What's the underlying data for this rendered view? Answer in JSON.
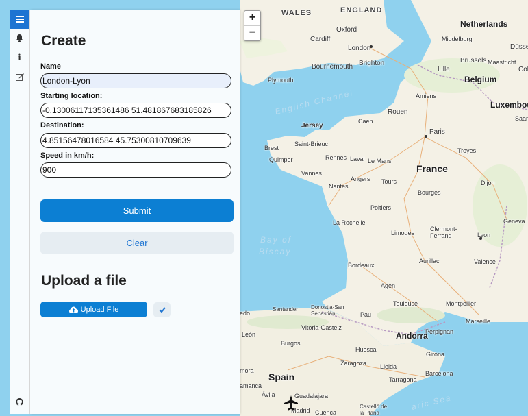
{
  "map": {
    "zoom_in": "+",
    "zoom_out": "−",
    "labels": {
      "wales": "WALES",
      "england": "ENGLAND",
      "netherlands": "Netherlands",
      "oxford": "Oxford",
      "cardiff": "Cardiff",
      "london": "London",
      "middelburg": "Middelburg",
      "dusse": "Düsse",
      "bournemouth": "Bournemouth",
      "brighton": "Brighton",
      "brussels": "Brussels",
      "maastricht": "Maastricht",
      "lille": "Lille",
      "belgium": "Belgium",
      "col": "Col",
      "plymouth": "Plymouth",
      "english_channel": "English Channel",
      "amiens": "Amiens",
      "luxembourg": "Luxembour",
      "rouen": "Rouen",
      "saarb": "Saarb",
      "jersey": "Jersey",
      "caen": "Caen",
      "paris": "Paris",
      "brest": "Brest",
      "saint_brieuc": "Saint-Brieuc",
      "troyes": "Troyes",
      "quimper": "Quimper",
      "rennes": "Rennes",
      "laval": "Laval",
      "le_mans": "Le Mans",
      "vannes": "Vannes",
      "france": "France",
      "angers": "Angers",
      "tours": "Tours",
      "dijon": "Dijon",
      "nantes": "Nantes",
      "bourges": "Bourges",
      "poitiers": "Poitiers",
      "geneva": "Geneva",
      "la_rochelle": "La Rochelle",
      "limoges": "Limoges",
      "clermont": "Clermont-\nFerrand",
      "lyon": "Lyon",
      "bay": "Bay of",
      "biscay": "Biscay",
      "bordeaux": "Bordeaux",
      "aurillac": "Aurillac",
      "valence": "Valence",
      "agen": "Agen",
      "toulouse": "Toulouse",
      "montpellier": "Montpellier",
      "santander": "Santander",
      "donostia": "Donostia-San\nSebastián",
      "pau": "Pau",
      "marseille": "Marseille",
      "edo": "edo",
      "vitoria": "Vitoria-Gasteiz",
      "perpignan": "Perpignan",
      "andorra": "Andorra",
      "leon": "León",
      "burgos": "Burgos",
      "huesca": "Huesca",
      "girona": "Girona",
      "zaragoza": "Zaragoza",
      "lleida": "Lleida",
      "barcelona": "Barcelona",
      "mora": "mora",
      "spain": "Spain",
      "tarragona": "Tarragona",
      "amanca": "amanca",
      "avila": "Ávila",
      "guadalajara": "Guadalajara",
      "castellon": "Castelló de\nla Plana",
      "madrid": "Madrid",
      "cuenca": "Cuenca",
      "aric_sea": "aric Sea"
    }
  },
  "sidebar": {
    "tabs": [
      {
        "icon": "menu-icon",
        "glyph": "≡"
      },
      {
        "icon": "bell-icon",
        "glyph": "🔔"
      },
      {
        "icon": "info-icon",
        "glyph": "i"
      },
      {
        "icon": "edit-icon",
        "glyph": "✎"
      }
    ],
    "bottom_icon": "github-icon"
  },
  "panel": {
    "title": "Create",
    "name_label": "Name",
    "name_value": "London-Lyon",
    "start_label": "Starting location:",
    "start_value": "-0.13006117135361486 51.481867683185826",
    "dest_label": "Destination:",
    "dest_value": "4.85156478016584 45.75300810709639",
    "speed_label": "Speed in km/h:",
    "speed_value": "900",
    "submit_label": "Submit",
    "clear_label": "Clear",
    "upload_title": "Upload a file",
    "upload_label": "Upload File"
  },
  "colors": {
    "accent": "#0c7fd3",
    "tab_active": "#1d74d2",
    "sea": "#8fd1ee",
    "land": "#f4f1e6"
  }
}
